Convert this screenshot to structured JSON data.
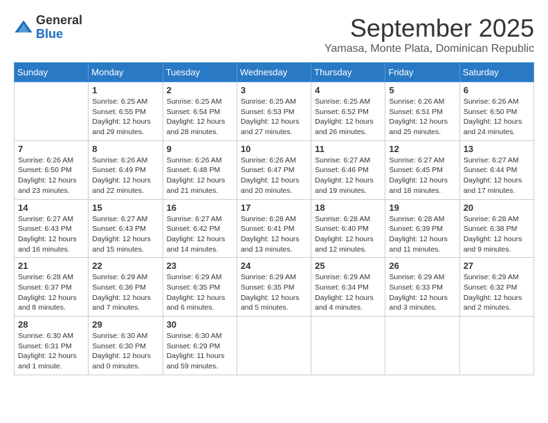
{
  "header": {
    "logo_general": "General",
    "logo_blue": "Blue",
    "month_title": "September 2025",
    "subtitle": "Yamasa, Monte Plata, Dominican Republic"
  },
  "weekdays": [
    "Sunday",
    "Monday",
    "Tuesday",
    "Wednesday",
    "Thursday",
    "Friday",
    "Saturday"
  ],
  "weeks": [
    [
      {
        "day": "",
        "sunrise": "",
        "sunset": "",
        "daylight": ""
      },
      {
        "day": "1",
        "sunrise": "Sunrise: 6:25 AM",
        "sunset": "Sunset: 6:55 PM",
        "daylight": "Daylight: 12 hours and 29 minutes."
      },
      {
        "day": "2",
        "sunrise": "Sunrise: 6:25 AM",
        "sunset": "Sunset: 6:54 PM",
        "daylight": "Daylight: 12 hours and 28 minutes."
      },
      {
        "day": "3",
        "sunrise": "Sunrise: 6:25 AM",
        "sunset": "Sunset: 6:53 PM",
        "daylight": "Daylight: 12 hours and 27 minutes."
      },
      {
        "day": "4",
        "sunrise": "Sunrise: 6:25 AM",
        "sunset": "Sunset: 6:52 PM",
        "daylight": "Daylight: 12 hours and 26 minutes."
      },
      {
        "day": "5",
        "sunrise": "Sunrise: 6:26 AM",
        "sunset": "Sunset: 6:51 PM",
        "daylight": "Daylight: 12 hours and 25 minutes."
      },
      {
        "day": "6",
        "sunrise": "Sunrise: 6:26 AM",
        "sunset": "Sunset: 6:50 PM",
        "daylight": "Daylight: 12 hours and 24 minutes."
      }
    ],
    [
      {
        "day": "7",
        "sunrise": "Sunrise: 6:26 AM",
        "sunset": "Sunset: 6:50 PM",
        "daylight": "Daylight: 12 hours and 23 minutes."
      },
      {
        "day": "8",
        "sunrise": "Sunrise: 6:26 AM",
        "sunset": "Sunset: 6:49 PM",
        "daylight": "Daylight: 12 hours and 22 minutes."
      },
      {
        "day": "9",
        "sunrise": "Sunrise: 6:26 AM",
        "sunset": "Sunset: 6:48 PM",
        "daylight": "Daylight: 12 hours and 21 minutes."
      },
      {
        "day": "10",
        "sunrise": "Sunrise: 6:26 AM",
        "sunset": "Sunset: 6:47 PM",
        "daylight": "Daylight: 12 hours and 20 minutes."
      },
      {
        "day": "11",
        "sunrise": "Sunrise: 6:27 AM",
        "sunset": "Sunset: 6:46 PM",
        "daylight": "Daylight: 12 hours and 19 minutes."
      },
      {
        "day": "12",
        "sunrise": "Sunrise: 6:27 AM",
        "sunset": "Sunset: 6:45 PM",
        "daylight": "Daylight: 12 hours and 18 minutes."
      },
      {
        "day": "13",
        "sunrise": "Sunrise: 6:27 AM",
        "sunset": "Sunset: 6:44 PM",
        "daylight": "Daylight: 12 hours and 17 minutes."
      }
    ],
    [
      {
        "day": "14",
        "sunrise": "Sunrise: 6:27 AM",
        "sunset": "Sunset: 6:43 PM",
        "daylight": "Daylight: 12 hours and 16 minutes."
      },
      {
        "day": "15",
        "sunrise": "Sunrise: 6:27 AM",
        "sunset": "Sunset: 6:43 PM",
        "daylight": "Daylight: 12 hours and 15 minutes."
      },
      {
        "day": "16",
        "sunrise": "Sunrise: 6:27 AM",
        "sunset": "Sunset: 6:42 PM",
        "daylight": "Daylight: 12 hours and 14 minutes."
      },
      {
        "day": "17",
        "sunrise": "Sunrise: 6:28 AM",
        "sunset": "Sunset: 6:41 PM",
        "daylight": "Daylight: 12 hours and 13 minutes."
      },
      {
        "day": "18",
        "sunrise": "Sunrise: 6:28 AM",
        "sunset": "Sunset: 6:40 PM",
        "daylight": "Daylight: 12 hours and 12 minutes."
      },
      {
        "day": "19",
        "sunrise": "Sunrise: 6:28 AM",
        "sunset": "Sunset: 6:39 PM",
        "daylight": "Daylight: 12 hours and 11 minutes."
      },
      {
        "day": "20",
        "sunrise": "Sunrise: 6:28 AM",
        "sunset": "Sunset: 6:38 PM",
        "daylight": "Daylight: 12 hours and 9 minutes."
      }
    ],
    [
      {
        "day": "21",
        "sunrise": "Sunrise: 6:28 AM",
        "sunset": "Sunset: 6:37 PM",
        "daylight": "Daylight: 12 hours and 8 minutes."
      },
      {
        "day": "22",
        "sunrise": "Sunrise: 6:29 AM",
        "sunset": "Sunset: 6:36 PM",
        "daylight": "Daylight: 12 hours and 7 minutes."
      },
      {
        "day": "23",
        "sunrise": "Sunrise: 6:29 AM",
        "sunset": "Sunset: 6:35 PM",
        "daylight": "Daylight: 12 hours and 6 minutes."
      },
      {
        "day": "24",
        "sunrise": "Sunrise: 6:29 AM",
        "sunset": "Sunset: 6:35 PM",
        "daylight": "Daylight: 12 hours and 5 minutes."
      },
      {
        "day": "25",
        "sunrise": "Sunrise: 6:29 AM",
        "sunset": "Sunset: 6:34 PM",
        "daylight": "Daylight: 12 hours and 4 minutes."
      },
      {
        "day": "26",
        "sunrise": "Sunrise: 6:29 AM",
        "sunset": "Sunset: 6:33 PM",
        "daylight": "Daylight: 12 hours and 3 minutes."
      },
      {
        "day": "27",
        "sunrise": "Sunrise: 6:29 AM",
        "sunset": "Sunset: 6:32 PM",
        "daylight": "Daylight: 12 hours and 2 minutes."
      }
    ],
    [
      {
        "day": "28",
        "sunrise": "Sunrise: 6:30 AM",
        "sunset": "Sunset: 6:31 PM",
        "daylight": "Daylight: 12 hours and 1 minute."
      },
      {
        "day": "29",
        "sunrise": "Sunrise: 6:30 AM",
        "sunset": "Sunset: 6:30 PM",
        "daylight": "Daylight: 12 hours and 0 minutes."
      },
      {
        "day": "30",
        "sunrise": "Sunrise: 6:30 AM",
        "sunset": "Sunset: 6:29 PM",
        "daylight": "Daylight: 11 hours and 59 minutes."
      },
      {
        "day": "",
        "sunrise": "",
        "sunset": "",
        "daylight": ""
      },
      {
        "day": "",
        "sunrise": "",
        "sunset": "",
        "daylight": ""
      },
      {
        "day": "",
        "sunrise": "",
        "sunset": "",
        "daylight": ""
      },
      {
        "day": "",
        "sunrise": "",
        "sunset": "",
        "daylight": ""
      }
    ]
  ]
}
